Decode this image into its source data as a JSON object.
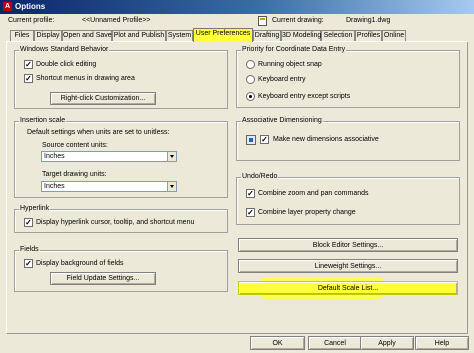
{
  "window": {
    "title": "Options"
  },
  "profile": {
    "label": "Current profile:",
    "value": "<<Unnamed Profile>>"
  },
  "drawing": {
    "label": "Current drawing:",
    "value": "Drawing1.dwg"
  },
  "tabs": [
    {
      "label": "Files"
    },
    {
      "label": "Display"
    },
    {
      "label": "Open and Save"
    },
    {
      "label": "Plot and Publish"
    },
    {
      "label": "System"
    },
    {
      "label": "User Preferences"
    },
    {
      "label": "Drafting"
    },
    {
      "label": "3D Modeling"
    },
    {
      "label": "Selection"
    },
    {
      "label": "Profiles"
    },
    {
      "label": "Online"
    }
  ],
  "windows_behavior": {
    "title": "Windows Standard Behavior",
    "double_click": "Double click editing",
    "shortcut_menus": "Shortcut menus in drawing area",
    "right_click_button": "Right-click Customization..."
  },
  "insertion_scale": {
    "title": "Insertion scale",
    "description": "Default settings when units are set to unitless:",
    "source_label": "Source content units:",
    "source_value": "Inches",
    "target_label": "Target drawing units:",
    "target_value": "Inches"
  },
  "hyperlink": {
    "title": "Hyperlink",
    "display": "Display hyperlink cursor, tooltip, and shortcut menu"
  },
  "fields": {
    "title": "Fields",
    "display_bg": "Display background of fields",
    "update_button": "Field Update Settings..."
  },
  "priority": {
    "title": "Priority for Coordinate Data Entry",
    "options": [
      "Running object snap",
      "Keyboard entry",
      "Keyboard entry except scripts"
    ],
    "selected_index": 2
  },
  "associative": {
    "title": "Associative Dimensioning",
    "make_new": "Make new dimensions associative"
  },
  "undo": {
    "title": "Undo/Redo",
    "combine_zoom": "Combine zoom and pan commands",
    "combine_layer": "Combine layer property change"
  },
  "buttons": {
    "block_editor": "Block Editor Settings...",
    "lineweight": "Lineweight Settings...",
    "default_scale": "Default Scale List..."
  },
  "footer": {
    "ok": "OK",
    "cancel": "Cancel",
    "apply": "Apply",
    "help": "Help"
  },
  "colors": {
    "highlight": "#ffff3a",
    "titlebar": "#0a246a",
    "dialog": "#ece9d8"
  }
}
